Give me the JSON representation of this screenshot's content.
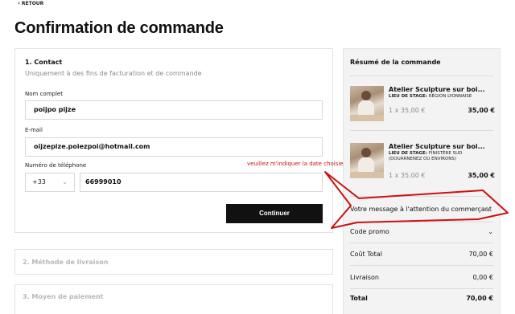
{
  "nav": {
    "back_label": "RETOUR"
  },
  "page": {
    "title": "Confirmation de commande"
  },
  "contact": {
    "section_title": "1. Contact",
    "subtitle": "Uniquement à des fins de facturation et de commande",
    "name_label": "Nom complet",
    "name_value": "poijpo pijze",
    "email_label": "E-mail",
    "email_value": "oijzepize.poiezpoi@hotmail.com",
    "phone_label": "Numéro de téléphone",
    "phone_code": "+33",
    "phone_value": "66999010",
    "continue_label": "Continuer"
  },
  "shipping": {
    "section_title": "2. Méthode de livraison"
  },
  "payment": {
    "section_title": "3. Moyen de paiement"
  },
  "summary": {
    "title": "Résumé de la commande",
    "items": [
      {
        "name": "Atelier Sculpture sur boi...",
        "location_label": "LIEU DE STAGE:",
        "location_value": "RÉGION LYONNAISE",
        "qty": "1 x 35,00 €",
        "price": "35,00 €"
      },
      {
        "name": "Atelier Sculpture sur boi...",
        "location_label": "LIEU DE STAGE:",
        "location_value": "FINISTÈRE SUD (DOUARNENEZ OU ENVIRONS)",
        "qty": "1 x 35,00 €",
        "price": "35,00 €"
      }
    ],
    "message_label": "Votre message à l'attention du commerçant",
    "promo_label": "Code promo",
    "subtotal_label": "Coût Total",
    "subtotal_value": "70,00 €",
    "shipping_label": "Livraison",
    "shipping_value": "0,00 €",
    "total_label": "Total",
    "total_value": "70,00 €"
  },
  "annotation": {
    "text": "veuillez m'indiquer la date choisie",
    "color": "#cc1111"
  }
}
